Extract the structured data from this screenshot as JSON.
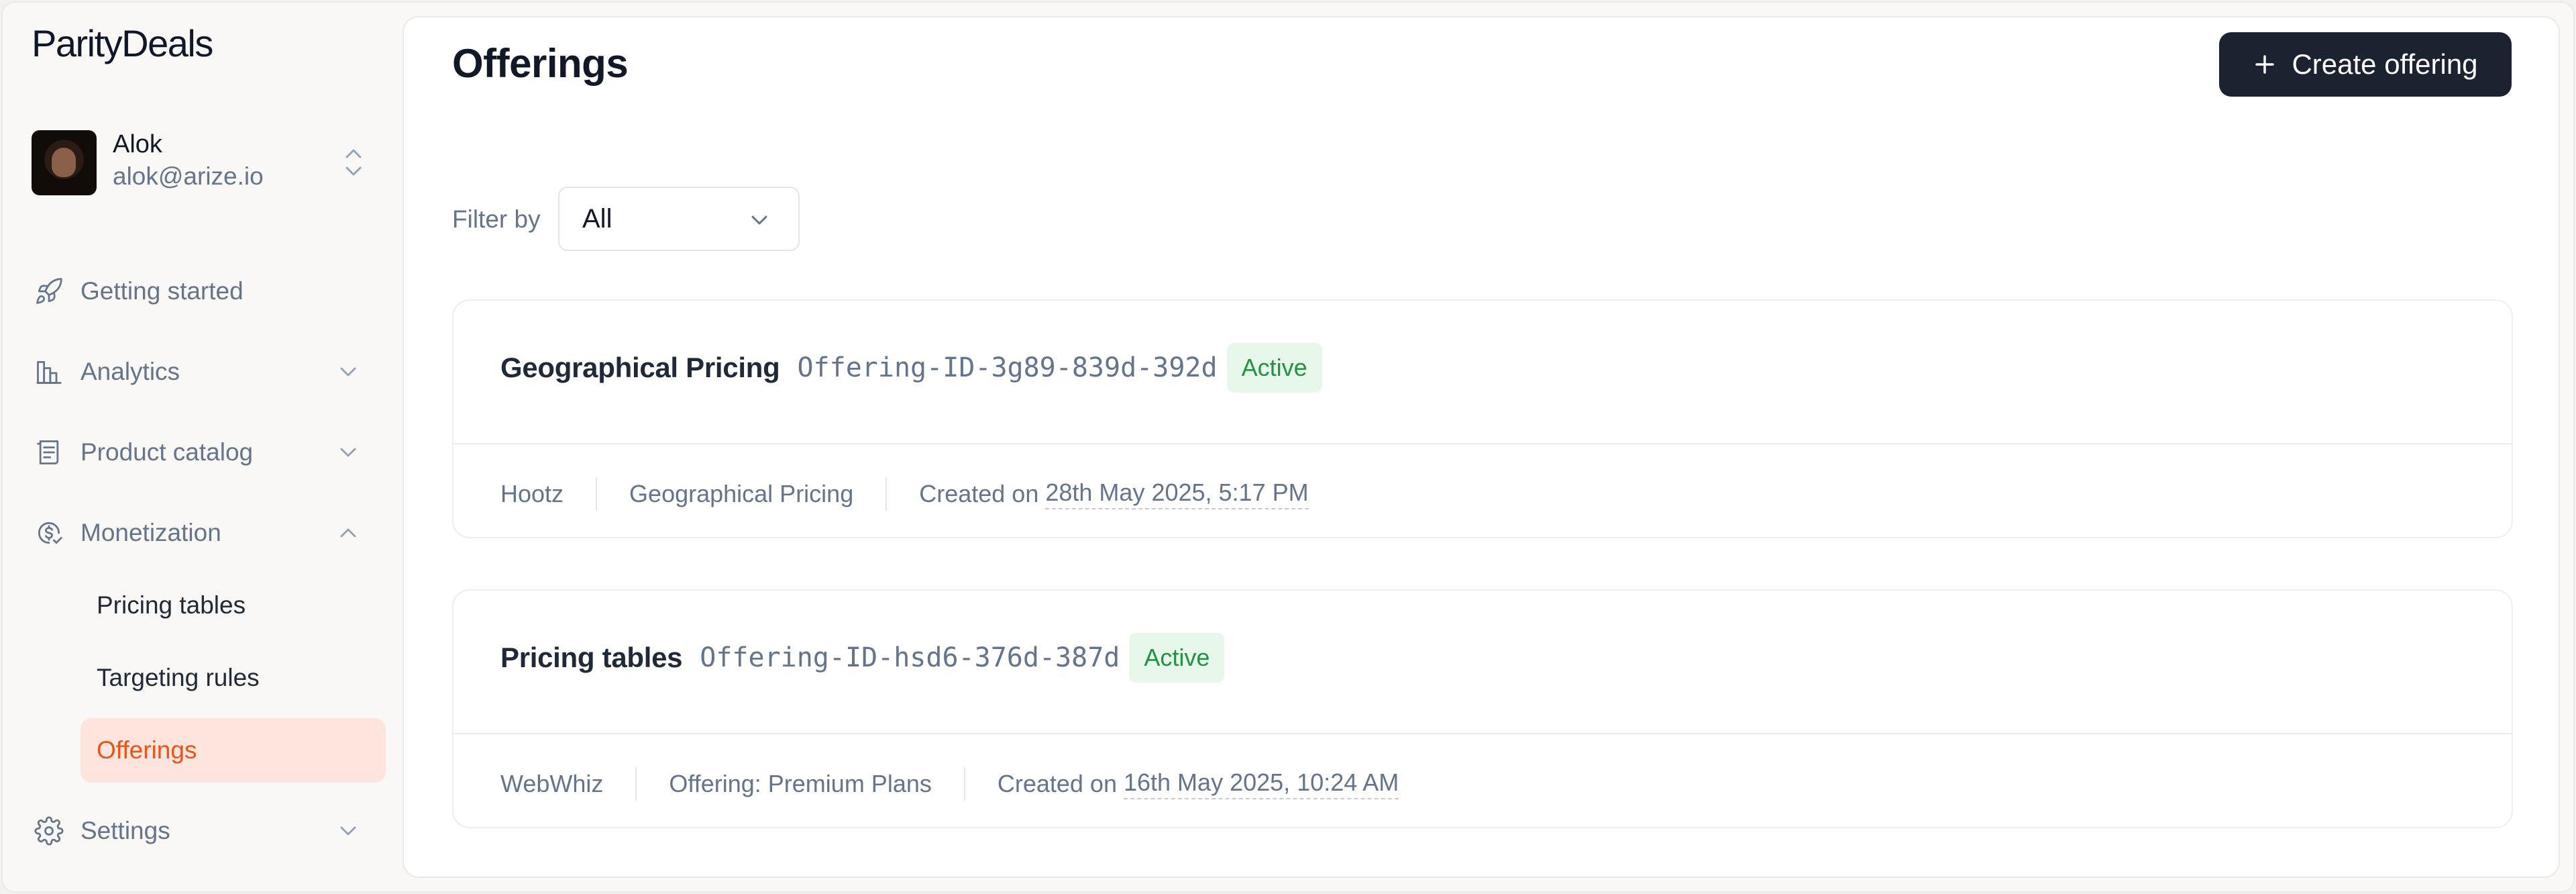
{
  "brand": {
    "name": "ParityDeals"
  },
  "account": {
    "name": "Alok",
    "email": "alok@arize.io"
  },
  "nav": {
    "getting_started": "Getting started",
    "analytics": "Analytics",
    "product_catalog": "Product catalog",
    "monetization": "Monetization",
    "monetization_sub": [
      "Pricing tables",
      "Targeting rules",
      "Offerings"
    ],
    "settings": "Settings"
  },
  "main": {
    "title": "Offerings",
    "create_button": "Create offering",
    "filter": {
      "label": "Filter by",
      "value": "All"
    }
  },
  "offerings": [
    {
      "title": "Geographical Pricing",
      "id": "Offering-ID-3g89-839d-392d",
      "status": "Active",
      "product": "Hootz",
      "type": "Geographical Pricing",
      "created_prefix": "Created on",
      "created_date": "28th May 2025, 5:17 PM"
    },
    {
      "title": "Pricing tables",
      "id": "Offering-ID-hsd6-376d-387d",
      "status": "Active",
      "product": "WebWhiz",
      "type": "Offering: Premium Plans",
      "created_prefix": "Created on",
      "created_date": "16th May 2025, 10:24 AM"
    }
  ],
  "colors": {
    "accent": "#e8541c",
    "active_bg": "#fde5dd",
    "badge_green": "#239341",
    "button_dark": "#1b2230"
  }
}
